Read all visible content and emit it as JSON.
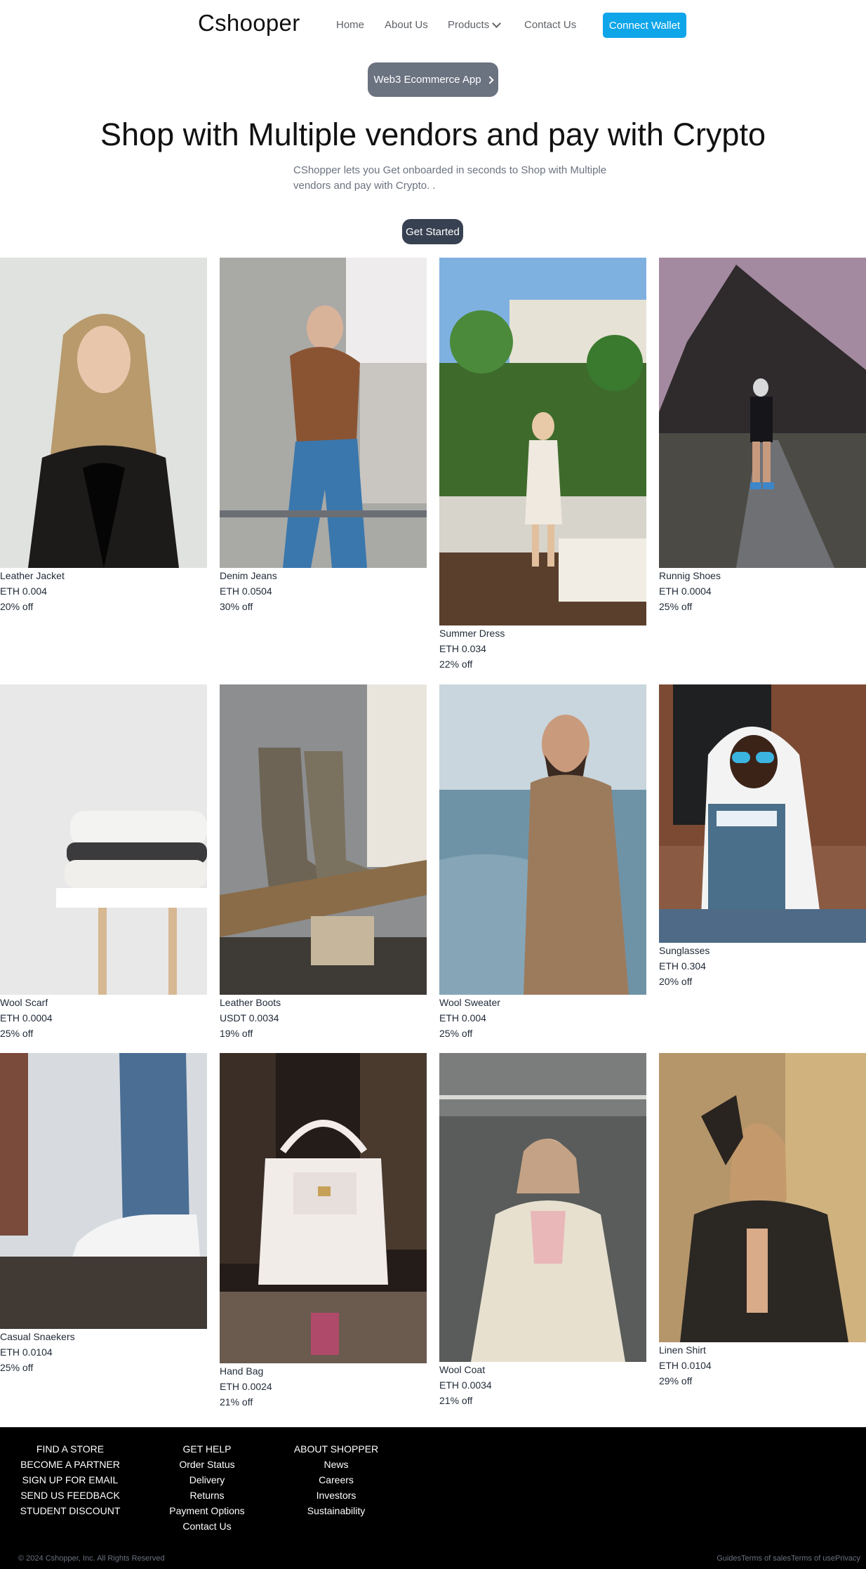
{
  "nav": {
    "brand": "Cshooper",
    "links": [
      "Home",
      "About Us",
      "Products",
      "Contact Us"
    ],
    "connect_label": "Connect Wallet",
    "icons": {
      "products_dropdown": "chevron-down-icon"
    },
    "colors": {
      "connect_button": "#0ea5e9",
      "link": "#5f6368"
    }
  },
  "hero": {
    "pill_label": "Web3 Ecommerce App",
    "title": "Shop with Multiple vendors and pay with Crypto",
    "subtitle": "CShopper lets you Get onboarded in seconds to Shop with Multiple vendors and pay with Crypto. .",
    "cta_label": "Get Started",
    "colors": {
      "pill": "#6b7280",
      "cta": "#374151"
    }
  },
  "products": [
    {
      "name": "Leather Jacket",
      "price": "ETH 0.004",
      "discount": "20% off"
    },
    {
      "name": "Denim Jeans",
      "price": "ETH 0.0504",
      "discount": "30% off"
    },
    {
      "name": "Summer Dress",
      "price": "ETH 0.034",
      "discount": "22% off"
    },
    {
      "name": "Runnig Shoes",
      "price": "ETH 0.0004",
      "discount": "25% off"
    },
    {
      "name": "Wool Scarf",
      "price": "ETH 0.0004",
      "discount": "25% off"
    },
    {
      "name": "Leather Boots",
      "price": "USDT 0.0034",
      "discount": "19% off"
    },
    {
      "name": "Wool Sweater",
      "price": "ETH 0.004",
      "discount": "25% off"
    },
    {
      "name": "Sunglasses",
      "price": "ETH 0.304",
      "discount": "20% off"
    },
    {
      "name": "Casual Snaekers",
      "price": "ETH 0.0104",
      "discount": "25% off"
    },
    {
      "name": "Hand Bag",
      "price": "ETH 0.0024",
      "discount": "21% off"
    },
    {
      "name": "Wool Coat",
      "price": "ETH 0.0034",
      "discount": "21% off"
    },
    {
      "name": "Linen Shirt",
      "price": "ETH 0.0104",
      "discount": "29% off"
    }
  ],
  "footer": {
    "col1": [
      "FIND A STORE",
      "BECOME A PARTNER",
      "SIGN UP FOR EMAIL",
      "SEND US FEEDBACK",
      "STUDENT DISCOUNT"
    ],
    "col2": {
      "heading": "GET HELP",
      "items": [
        "Order Status",
        "Delivery",
        "Returns",
        "Payment Options",
        "Contact Us"
      ]
    },
    "col3": {
      "heading": "ABOUT SHOPPER",
      "items": [
        "News",
        "Careers",
        "Investors",
        "Sustainability"
      ]
    },
    "copyright": "© 2024 Cshopper, Inc. All Rights Reserved",
    "legal": [
      "Guides",
      "Terms of sales",
      "Terms of use",
      "Privacy"
    ]
  }
}
